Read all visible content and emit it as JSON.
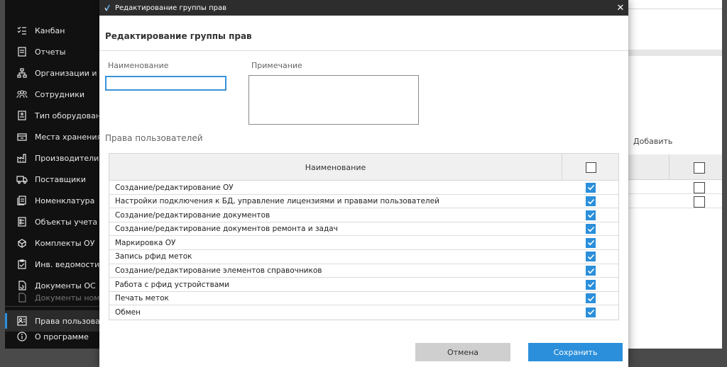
{
  "colors": {
    "accent": "#2b8fdb",
    "sidebar_bg": "#111111",
    "titlebar_bg": "#2d2d2d"
  },
  "sidebar": {
    "items": [
      {
        "label": "Канбан",
        "icon": "kanban-list-icon"
      },
      {
        "label": "Отчеты",
        "icon": "report-icon"
      },
      {
        "label": "Организации и отд",
        "icon": "org-structure-icon"
      },
      {
        "label": "Сотрудники",
        "icon": "people-icon"
      },
      {
        "label": "Тип оборудования",
        "icon": "equipment-type-icon"
      },
      {
        "label": "Места хранения",
        "icon": "storage-icon"
      },
      {
        "label": "Производители",
        "icon": "factory-icon"
      },
      {
        "label": "Поставщики",
        "icon": "truck-icon"
      },
      {
        "label": "Номенклатура",
        "icon": "nomenclature-icon"
      },
      {
        "label": "Объекты учета",
        "icon": "objects-icon"
      },
      {
        "label": "Комплекты ОУ",
        "icon": "kit-icon"
      },
      {
        "label": "Инв. ведомости",
        "icon": "clipboard-icon"
      },
      {
        "label": "Документы ОС",
        "icon": "documents-icon"
      },
      {
        "label": "Документы номенк",
        "icon": "documents-icon"
      },
      {
        "label": "Права пользовате",
        "icon": "user-rights-icon"
      },
      {
        "label": "О программе",
        "icon": "info-icon"
      }
    ]
  },
  "background": {
    "add_label": "Добавить"
  },
  "dialog": {
    "window_title": "Редактирование группы прав",
    "heading": "Редактирование группы прав",
    "name_label": "Наименование",
    "name_value": "",
    "note_label": "Примечание",
    "note_value": "",
    "section_title": "Права пользователей",
    "table": {
      "header_name": "Наименование",
      "rows": [
        {
          "name": "Создание/редактирование ОУ",
          "checked": true
        },
        {
          "name": "Настройки подключения к БД, управление лицензиями и правами пользователей",
          "checked": true
        },
        {
          "name": "Создание/редактирование документов",
          "checked": true
        },
        {
          "name": "Создание/редактирование документов ремонта и задач",
          "checked": true
        },
        {
          "name": "Маркировка ОУ",
          "checked": true
        },
        {
          "name": "Запись рфид меток",
          "checked": true
        },
        {
          "name": "Создание/редактирование элементов справочников",
          "checked": true
        },
        {
          "name": "Работа с рфид устройствами",
          "checked": true
        },
        {
          "name": "Печать меток",
          "checked": true
        },
        {
          "name": "Обмен",
          "checked": true
        }
      ]
    },
    "cancel_label": "Отмена",
    "save_label": "Сохранить"
  }
}
